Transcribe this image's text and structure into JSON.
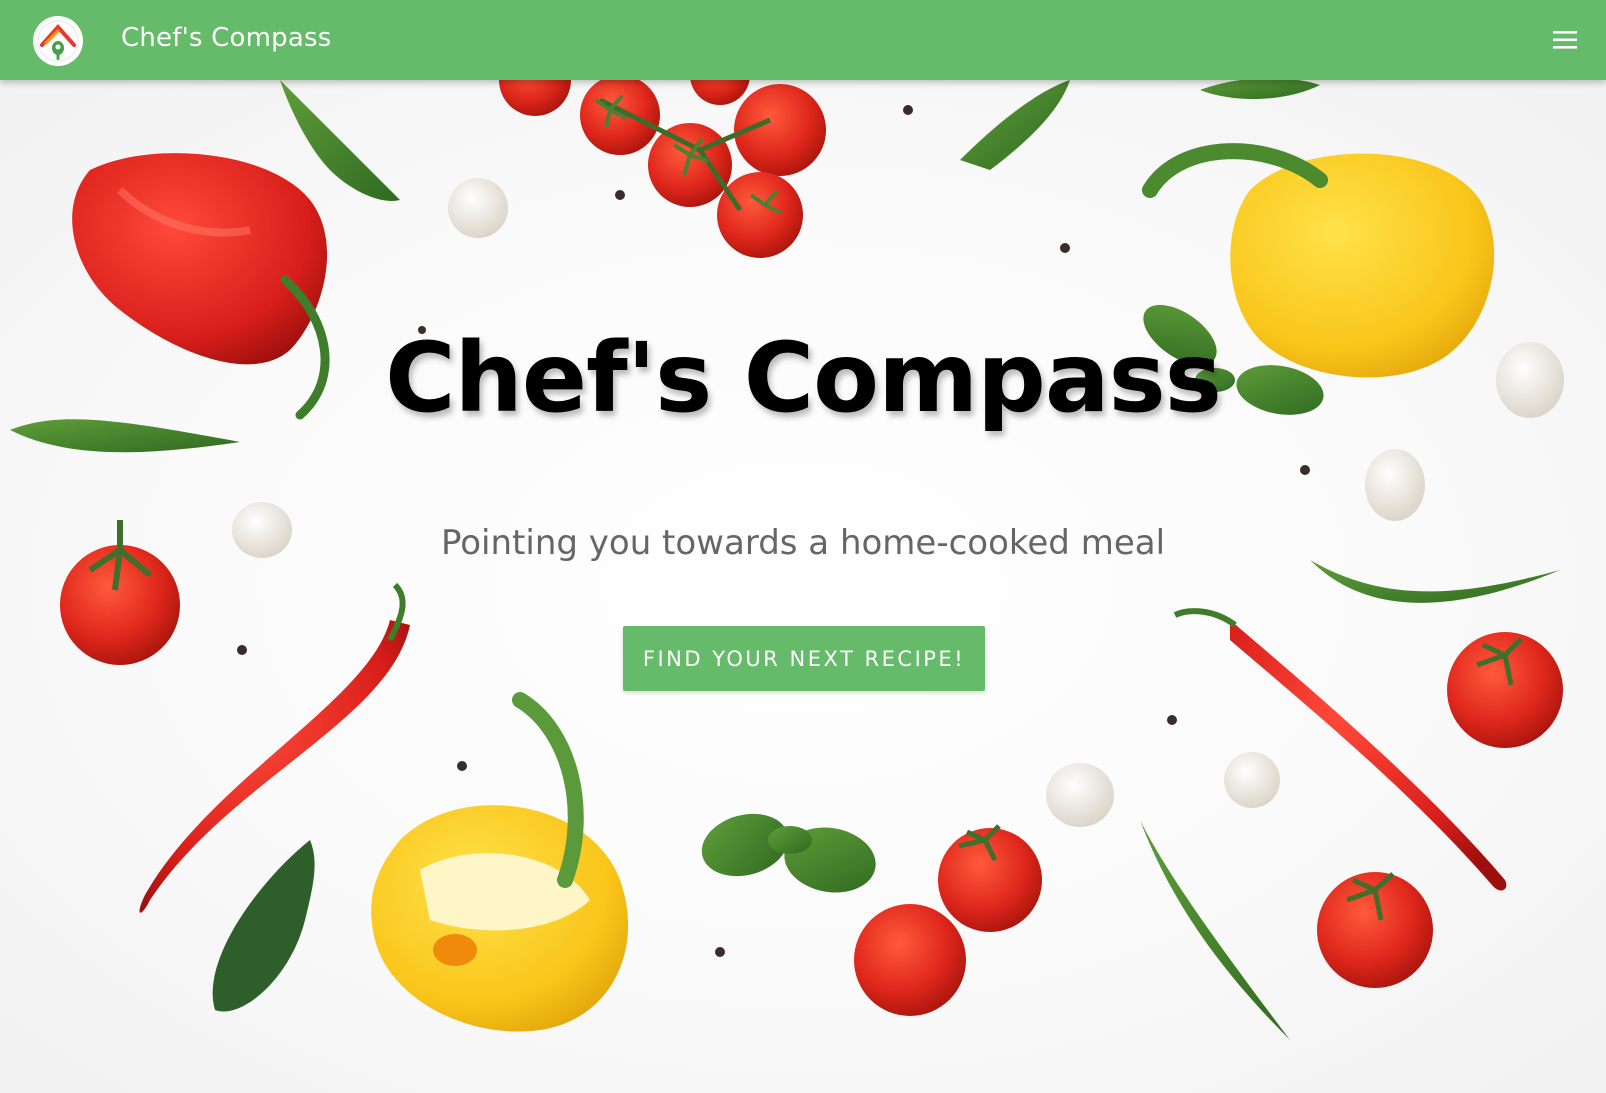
{
  "navbar": {
    "brand": "Chef's Compass",
    "logo_icon": "compass-house-logo-icon",
    "menu_icon": "hamburger-menu-icon",
    "color": "#66bb6a"
  },
  "hero": {
    "title": "Chef's Compass",
    "subtitle": "Pointing you towards a home-cooked meal",
    "cta_label": "FIND YOUR NEXT RECIPE!",
    "background_image": "vegetables-flatlay"
  },
  "colors": {
    "accent": "#66bb6a",
    "text_primary": "#000000",
    "text_secondary": "#666666",
    "button_text": "#ffffff"
  }
}
